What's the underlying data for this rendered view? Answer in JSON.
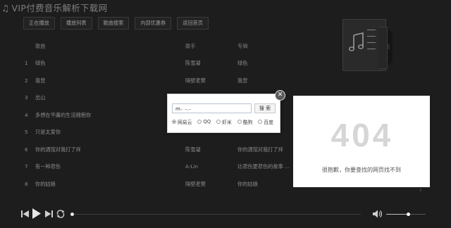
{
  "app": {
    "title": "VIP付费音乐解析下载网"
  },
  "tabs": [
    {
      "label": "正在播放"
    },
    {
      "label": "播放列表"
    },
    {
      "label": "歌曲搜索"
    },
    {
      "label": "内部优惠券"
    },
    {
      "label": "返回首页"
    }
  ],
  "table": {
    "headers": {
      "title": "歌曲",
      "artist": "歌手",
      "album": "专辑"
    },
    "rows": [
      {
        "num": "1",
        "title": "绿色",
        "artist": "陈雪凝",
        "album": "绿色"
      },
      {
        "num": "2",
        "title": "我曾",
        "artist": "隔壁老樊",
        "album": "我曾"
      },
      {
        "num": "3",
        "title": "出山",
        "artist": "",
        "album": ""
      },
      {
        "num": "4",
        "title": "多想在平庸的生活拥抱你",
        "artist": "",
        "album": ""
      },
      {
        "num": "5",
        "title": "只是太爱你",
        "artist": "",
        "album": ""
      },
      {
        "num": "6",
        "title": "你的酒馆对我打了烊",
        "artist": "陈雪凝",
        "album": "你的酒馆对我打了烊"
      },
      {
        "num": "7",
        "title": "有一种悲伤",
        "artist": "A-Lin",
        "album": "比悲伤更悲伤的故事 ..."
      },
      {
        "num": "8",
        "title": "你的姑娘",
        "artist": "隔壁老樊",
        "album": "你的姑娘"
      }
    ]
  },
  "search_dialog": {
    "input_value": "m₋    ₋.₋",
    "search_button": "搜 索",
    "sources": [
      {
        "label": "网易云",
        "selected": true
      },
      {
        "label": "QQ",
        "selected": false
      },
      {
        "label": "虾米",
        "selected": false
      },
      {
        "label": "酷狗",
        "selected": false
      },
      {
        "label": "百度",
        "selected": false
      }
    ]
  },
  "error_panel": {
    "code": "404",
    "message": "很抱歉，你要查找的网页找不到"
  },
  "player": {
    "progress_fraction": 0.0,
    "volume_fraction": 0.55
  },
  "icons": {
    "prev": "previous-track-icon",
    "play": "play-icon",
    "next": "next-track-icon",
    "loop": "loop-icon",
    "volume": "volume-icon",
    "close": "close-icon",
    "cover": "music-note-icon"
  }
}
